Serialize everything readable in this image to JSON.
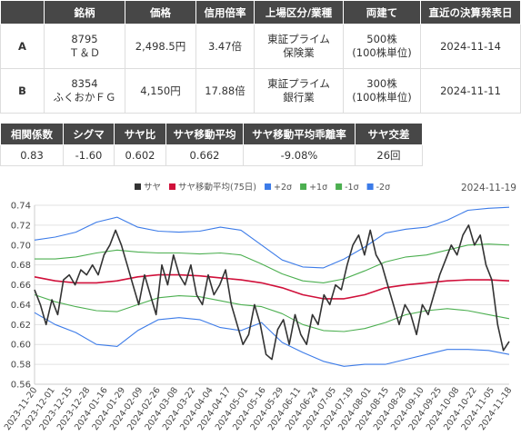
{
  "table": {
    "headers": [
      "",
      "銘柄",
      "価格",
      "信用倍率",
      "上場区分/業種",
      "両建て",
      "直近の決算発表日"
    ],
    "rows": [
      {
        "label": "A",
        "code": "8795",
        "name": "Ｔ＆Ｄ",
        "price": "2,498.5円",
        "margin": "3.47倍",
        "market": "東証プライム",
        "industry": "保険業",
        "lot": "500株",
        "unit": "(100株単位)",
        "date": "2024-11-14"
      },
      {
        "label": "B",
        "code": "8354",
        "name": "ふくおかＦＧ",
        "price": "4,150円",
        "margin": "17.88倍",
        "market": "東証プライム",
        "industry": "銀行業",
        "lot": "300株",
        "unit": "(100株単位)",
        "date": "2024-11-11"
      }
    ]
  },
  "stats": {
    "headers": [
      "相関係数",
      "シグマ",
      "サヤ比",
      "サヤ移動平均",
      "サヤ移動平均乖離率",
      "サヤ交差"
    ],
    "values": [
      "0.83",
      "-1.60",
      "0.602",
      "0.662",
      "-9.08%",
      "26回"
    ]
  },
  "chart_data": {
    "type": "line",
    "date_label": "2024-11-19",
    "legend": [
      {
        "name": "サヤ",
        "color": "#333333"
      },
      {
        "name": "サヤ移動平均(75日)",
        "color": "#d0103a"
      },
      {
        "name": "+2σ",
        "color": "#3c7be8"
      },
      {
        "name": "+1σ",
        "color": "#4caf50"
      },
      {
        "name": "-1σ",
        "color": "#4caf50"
      },
      {
        "name": "-2σ",
        "color": "#3c7be8"
      }
    ],
    "ylim": [
      0.56,
      0.74
    ],
    "yticks": [
      "0.56",
      "0.58",
      "0.60",
      "0.62",
      "0.64",
      "0.66",
      "0.68",
      "0.70",
      "0.72",
      "0.74"
    ],
    "xticks": [
      "2023-11-20",
      "2023-12-01",
      "2023-12-15",
      "2023-12-28",
      "2024-01-16",
      "2024-01-29",
      "2024-02-09",
      "2024-02-26",
      "2024-03-08",
      "2024-03-22",
      "2024-04-04",
      "2024-04-17",
      "2024-05-01",
      "2024-05-16",
      "2024-05-29",
      "2024-06-11",
      "2024-06-24",
      "2024-07-05",
      "2024-07-19",
      "2024-08-01",
      "2024-08-15",
      "2024-08-28",
      "2024-09-10",
      "2024-09-25",
      "2024-10-08",
      "2024-10-22",
      "2024-11-05",
      "2024-11-18"
    ],
    "series": [
      {
        "name": "サヤ",
        "key": "ratio",
        "values": [
          0.655,
          0.64,
          0.62,
          0.645,
          0.63,
          0.665,
          0.67,
          0.66,
          0.675,
          0.67,
          0.68,
          0.67,
          0.69,
          0.7,
          0.715,
          0.7,
          0.68,
          0.66,
          0.64,
          0.67,
          0.65,
          0.63,
          0.68,
          0.66,
          0.69,
          0.67,
          0.66,
          0.68,
          0.65,
          0.64,
          0.67,
          0.65,
          0.66,
          0.675,
          0.64,
          0.62,
          0.6,
          0.61,
          0.64,
          0.62,
          0.59,
          0.585,
          0.615,
          0.625,
          0.6,
          0.63,
          0.61,
          0.6,
          0.63,
          0.62,
          0.65,
          0.64,
          0.66,
          0.655,
          0.68,
          0.7,
          0.71,
          0.69,
          0.715,
          0.69,
          0.68,
          0.66,
          0.64,
          0.62,
          0.64,
          0.63,
          0.61,
          0.64,
          0.63,
          0.65,
          0.67,
          0.685,
          0.7,
          0.69,
          0.71,
          0.72,
          0.7,
          0.71,
          0.68,
          0.665,
          0.62,
          0.594,
          0.603
        ]
      },
      {
        "name": "サヤ移動平均(75日)",
        "key": "ma",
        "values": [
          0.668,
          0.664,
          0.662,
          0.662,
          0.664,
          0.668,
          0.67,
          0.67,
          0.669,
          0.667,
          0.665,
          0.662,
          0.657,
          0.65,
          0.646,
          0.646,
          0.65,
          0.657,
          0.66,
          0.662,
          0.664,
          0.665,
          0.665,
          0.664
        ]
      },
      {
        "name": "+2σ",
        "key": "p2",
        "values": [
          0.705,
          0.708,
          0.713,
          0.723,
          0.728,
          0.718,
          0.714,
          0.713,
          0.714,
          0.718,
          0.715,
          0.7,
          0.685,
          0.678,
          0.677,
          0.686,
          0.698,
          0.712,
          0.716,
          0.718,
          0.725,
          0.735,
          0.737,
          0.738
        ]
      },
      {
        "name": "+1σ",
        "key": "p1",
        "values": [
          0.686,
          0.686,
          0.688,
          0.692,
          0.695,
          0.693,
          0.692,
          0.692,
          0.691,
          0.692,
          0.69,
          0.681,
          0.671,
          0.664,
          0.662,
          0.666,
          0.674,
          0.683,
          0.688,
          0.69,
          0.695,
          0.7,
          0.701,
          0.7
        ]
      },
      {
        "name": "-1σ",
        "key": "m1",
        "values": [
          0.65,
          0.643,
          0.638,
          0.634,
          0.633,
          0.64,
          0.647,
          0.649,
          0.648,
          0.644,
          0.64,
          0.638,
          0.631,
          0.62,
          0.614,
          0.613,
          0.616,
          0.622,
          0.63,
          0.634,
          0.636,
          0.634,
          0.63,
          0.626
        ]
      },
      {
        "name": "-2σ",
        "key": "m2",
        "values": [
          0.632,
          0.62,
          0.612,
          0.6,
          0.598,
          0.614,
          0.625,
          0.627,
          0.625,
          0.617,
          0.614,
          0.622,
          0.602,
          0.592,
          0.583,
          0.578,
          0.58,
          0.58,
          0.585,
          0.59,
          0.595,
          0.595,
          0.594,
          0.59
        ]
      }
    ]
  }
}
